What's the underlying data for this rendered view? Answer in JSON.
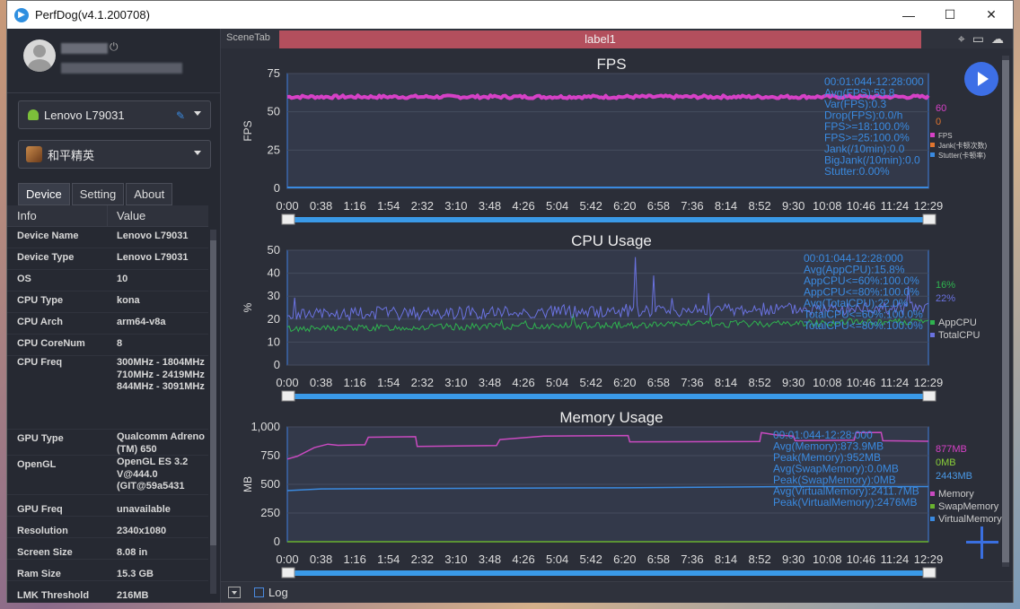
{
  "window": {
    "title": "PerfDog(v4.1.200708)"
  },
  "window_controls": {
    "minimize": "—",
    "maximize": "☐",
    "close": "✕"
  },
  "device_select": {
    "value": "Lenovo L79031"
  },
  "app_select": {
    "value": "和平精英"
  },
  "tabs": [
    {
      "label": "Device"
    },
    {
      "label": "Setting"
    },
    {
      "label": "About"
    }
  ],
  "table": {
    "header_info": "Info",
    "header_value": "Value",
    "rows": [
      {
        "key": "Device Name",
        "value": "Lenovo L79031"
      },
      {
        "key": "Device Type",
        "value": "Lenovo L79031"
      },
      {
        "key": "OS",
        "value": "10"
      },
      {
        "key": "CPU Type",
        "value": "kona"
      },
      {
        "key": "CPU Arch",
        "value": "arm64-v8a"
      },
      {
        "key": "CPU CoreNum",
        "value": "8"
      },
      {
        "key": "CPU Freq",
        "value": "300MHz - 1804MHz 710MHz - 2419MHz 844MHz - 3091MHz"
      },
      {
        "key": "GPU Type",
        "value": "Qualcomm Adreno (TM) 650"
      },
      {
        "key": "OpenGL",
        "value": "OpenGL ES 3.2 V@444.0 (GIT@59a5431"
      },
      {
        "key": "GPU Freq",
        "value": "unavailable"
      },
      {
        "key": "Resolution",
        "value": "2340x1080"
      },
      {
        "key": "Screen Size",
        "value": "8.08 in"
      },
      {
        "key": "Ram Size",
        "value": "15.3 GB"
      },
      {
        "key": "LMK Threshold",
        "value": "216MB"
      }
    ]
  },
  "scene": {
    "tab_label": "SceneTab",
    "label": "label1"
  },
  "bottom": {
    "log_label": "Log"
  },
  "colors": {
    "fps": "#d641c6",
    "jank": "#e0752f",
    "stutter": "#3a8ae0",
    "appcpu": "#2fb34f",
    "totalcpu": "#6a72e0",
    "memory": "#c94ac0",
    "swap": "#6ab32f",
    "virtual": "#3a8ae0",
    "stats": "#3a8ae0",
    "play_button": "#3d6fe6"
  },
  "icons": [
    "app-logo-icon",
    "android-icon",
    "pen-icon",
    "location-icon",
    "folder-icon",
    "cloud-icon",
    "play-icon",
    "plus-icon",
    "power-icon"
  ],
  "chart_data": [
    {
      "type": "line",
      "title": "FPS",
      "ylabel": "FPS",
      "ylim": [
        0,
        75
      ],
      "yticks": [
        "75",
        "50",
        "25",
        "0"
      ],
      "xticks": [
        "0:00",
        "0:38",
        "1:16",
        "1:54",
        "2:32",
        "3:10",
        "3:48",
        "4:26",
        "5:04",
        "5:42",
        "6:20",
        "6:58",
        "7:36",
        "8:14",
        "8:52",
        "9:30",
        "10:08",
        "10:46",
        "11:24",
        "12:29"
      ],
      "series": [
        {
          "name": "FPS",
          "flat_value": 59.8,
          "noise": 1.0
        }
      ],
      "stats": [
        "00:01:044-12:28:000",
        "Avg(FPS):59.8",
        "Var(FPS):0.3",
        "Drop(FPS):0.0/h",
        "FPS>=18:100.0%",
        "FPS>=25:100.0%",
        "Jank(/10min):0.0",
        "BigJank(/10min):0.0",
        "Stutter:0.00%"
      ],
      "current": [
        "60",
        "0"
      ],
      "legend": [
        "FPS",
        "Jank(卡顿次数)",
        "Stutter(卡顿率)"
      ]
    },
    {
      "type": "line",
      "title": "CPU Usage",
      "ylabel": "%",
      "ylim": [
        0,
        50
      ],
      "yticks": [
        "50",
        "40",
        "30",
        "20",
        "10",
        "0"
      ],
      "xticks": [
        "0:00",
        "0:38",
        "1:16",
        "1:54",
        "2:32",
        "3:10",
        "3:48",
        "4:26",
        "5:04",
        "5:42",
        "6:20",
        "6:58",
        "7:36",
        "8:14",
        "8:52",
        "9:30",
        "10:08",
        "10:46",
        "11:24",
        "12:29"
      ],
      "series": [
        {
          "name": "AppCPU",
          "base": 15.8
        },
        {
          "name": "TotalCPU",
          "base": 22.0
        }
      ],
      "stats": [
        "00:01:044-12:28:000",
        "Avg(AppCPU):15.8%",
        "AppCPU<=60%:100.0%",
        "AppCPU<=80%:100.0%",
        "Avg(TotalCPU):22.0%",
        "TotalCPU<=60%:100.0%",
        "TotalCPU<=80%:100.0%"
      ],
      "current": [
        "16%",
        "22%"
      ],
      "legend": [
        "AppCPU",
        "TotalCPU"
      ]
    },
    {
      "type": "line",
      "title": "Memory Usage",
      "ylabel": "MB",
      "ylim": [
        0,
        1000
      ],
      "yticks": [
        "1,000",
        "750",
        "500",
        "250",
        "0"
      ],
      "xticks": [
        "0:00",
        "0:38",
        "1:16",
        "1:54",
        "2:32",
        "3:10",
        "3:48",
        "4:26",
        "5:04",
        "5:42",
        "6:20",
        "6:58",
        "7:36",
        "8:14",
        "8:52",
        "9:30",
        "10:08",
        "10:46",
        "11:24",
        "12:29"
      ],
      "series": [
        {
          "name": "Memory",
          "points": [
            [
              0,
              720
            ],
            [
              0.3,
              745
            ],
            [
              0.8,
              820
            ],
            [
              1.2,
              850
            ],
            [
              1.5,
              840
            ],
            [
              2.3,
              845
            ],
            [
              2.4,
              910
            ],
            [
              3.8,
              915
            ],
            [
              3.85,
              830
            ],
            [
              6.2,
              838
            ],
            [
              6.3,
              890
            ],
            [
              7.6,
              920
            ],
            [
              10.1,
              925
            ],
            [
              10.15,
              870
            ],
            [
              14.0,
              873
            ],
            [
              14.05,
              950
            ],
            [
              14.5,
              930
            ],
            [
              15.0,
              920
            ],
            [
              15.05,
              880
            ],
            [
              16.8,
              885
            ],
            [
              16.85,
              950
            ],
            [
              17.6,
              952
            ],
            [
              17.65,
              880
            ],
            [
              19.0,
              875
            ]
          ]
        },
        {
          "name": "SwapMemory",
          "points": [
            [
              0,
              0
            ],
            [
              19,
              0
            ]
          ]
        },
        {
          "name": "VirtualMemory",
          "points": [
            [
              0,
              445
            ],
            [
              1.0,
              460
            ],
            [
              2.0,
              462
            ],
            [
              5.0,
              465
            ],
            [
              10.0,
              470
            ],
            [
              15.0,
              480
            ],
            [
              19.0,
              480
            ]
          ]
        }
      ],
      "stats": [
        "00:01:044-12:28:000",
        "Avg(Memory):873.9MB",
        "Peak(Memory):952MB",
        "Avg(SwapMemory):0.0MB",
        "Peak(SwapMemory):0MB",
        "Avg(VirtualMemory):2411.7MB",
        "Peak(VirtualMemory):2476MB"
      ],
      "current": [
        "877MB",
        "0MB",
        "2443MB"
      ],
      "legend": [
        "Memory",
        "SwapMemory",
        "VirtualMemory"
      ]
    }
  ]
}
